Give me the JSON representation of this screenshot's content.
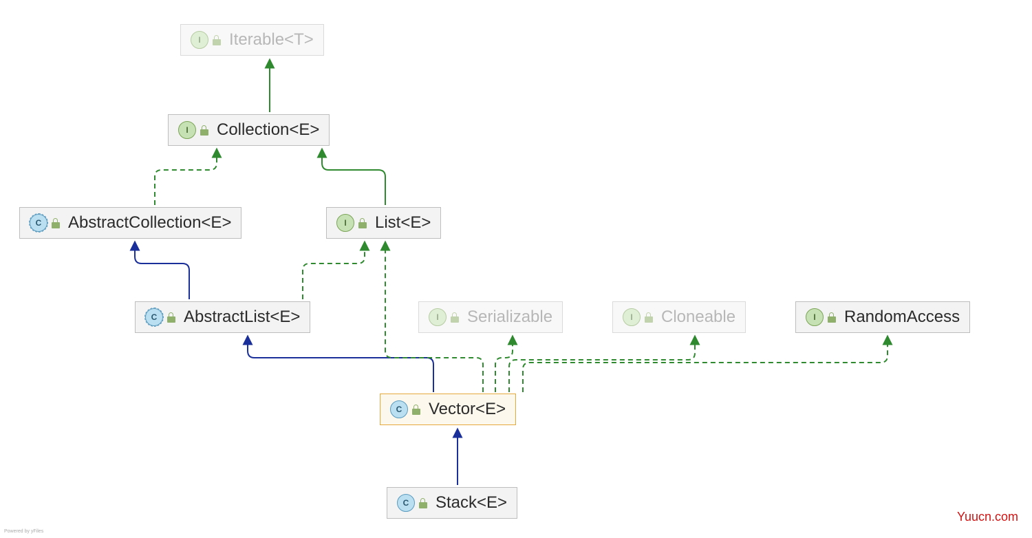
{
  "nodes": {
    "iterable": {
      "label": "Iterable<T>",
      "type_letter": "I"
    },
    "collection": {
      "label": "Collection<E>",
      "type_letter": "I"
    },
    "abscol": {
      "label": "AbstractCollection<E>",
      "type_letter": "C"
    },
    "list": {
      "label": "List<E>",
      "type_letter": "I"
    },
    "abslist": {
      "label": "AbstractList<E>",
      "type_letter": "C"
    },
    "serial": {
      "label": "Serializable",
      "type_letter": "I"
    },
    "clone": {
      "label": "Cloneable",
      "type_letter": "I"
    },
    "random": {
      "label": "RandomAccess",
      "type_letter": "I"
    },
    "vector": {
      "label": "Vector<E>",
      "type_letter": "C"
    },
    "stack": {
      "label": "Stack<E>",
      "type_letter": "C"
    }
  },
  "watermark": "Yuucn.com",
  "powered": "Powered by yFiles",
  "relationships": [
    {
      "from": "collection",
      "to": "iterable",
      "kind": "extends-interface"
    },
    {
      "from": "abscol",
      "to": "collection",
      "kind": "implements"
    },
    {
      "from": "list",
      "to": "collection",
      "kind": "extends-interface"
    },
    {
      "from": "abslist",
      "to": "abscol",
      "kind": "extends-class"
    },
    {
      "from": "abslist",
      "to": "list",
      "kind": "implements"
    },
    {
      "from": "vector",
      "to": "abslist",
      "kind": "extends-class"
    },
    {
      "from": "vector",
      "to": "list",
      "kind": "implements"
    },
    {
      "from": "vector",
      "to": "serial",
      "kind": "implements"
    },
    {
      "from": "vector",
      "to": "clone",
      "kind": "implements"
    },
    {
      "from": "vector",
      "to": "random",
      "kind": "implements"
    },
    {
      "from": "stack",
      "to": "vector",
      "kind": "extends-class"
    }
  ],
  "colors": {
    "extends_class": "#1a2f9a",
    "extends_interface": "#2f8a2f",
    "implements": "#2f8a2f"
  }
}
